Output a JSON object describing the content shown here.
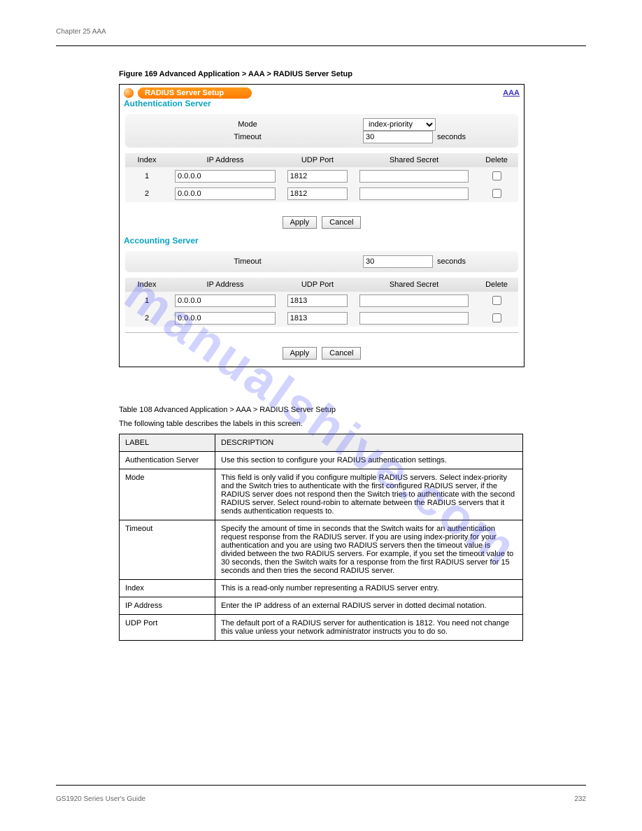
{
  "header": {
    "left": "Chapter 25 AAA",
    "right": ""
  },
  "footer": {
    "left": "GS1920 Series User's Guide",
    "right": "232"
  },
  "fig_caption": "Figure 169   Advanced Application > AAA > RADIUS Server Setup",
  "tbl_caption": "Table 108   Advanced Application > AAA > RADIUS Server Setup",
  "tbl_desc": "The following table describes the labels in this screen.",
  "watermark": "manualshive.com",
  "screenshot": {
    "title": "RADIUS Server Setup",
    "link": "AAA",
    "auth_section": "Authentication Server",
    "acct_section": "Accounting Server",
    "mode_label": "Mode",
    "timeout_label": "Timeout",
    "seconds": "seconds",
    "mode_value": "index-priority",
    "auth_timeout": "30",
    "acct_timeout": "30",
    "cols": {
      "index": "Index",
      "ip": "IP Address",
      "port": "UDP Port",
      "secret": "Shared Secret",
      "del": "Delete"
    },
    "auth_rows": [
      {
        "idx": "1",
        "ip": "0.0.0.0",
        "port": "1812",
        "secret": ""
      },
      {
        "idx": "2",
        "ip": "0.0.0.0",
        "port": "1812",
        "secret": ""
      }
    ],
    "acct_rows": [
      {
        "idx": "1",
        "ip": "0.0.0.0",
        "port": "1813",
        "secret": ""
      },
      {
        "idx": "2",
        "ip": "0.0.0.0",
        "port": "1813",
        "secret": ""
      }
    ],
    "apply": "Apply",
    "cancel": "Cancel"
  },
  "desc_table": {
    "h0": "LABEL",
    "h1": "DESCRIPTION",
    "rows": [
      {
        "label": "Authentication Server",
        "desc": "Use this section to configure your RADIUS authentication settings."
      },
      {
        "label": "Mode",
        "desc": "This field is only valid if you configure multiple RADIUS servers.\nSelect index-priority and the Switch tries to authenticate with the first configured RADIUS server, if the RADIUS server does not respond then the Switch tries to authenticate with the second RADIUS server.\nSelect round-robin to alternate between the RADIUS servers that it sends authentication requests to."
      },
      {
        "label": "Timeout",
        "desc": "Specify the amount of time in seconds that the Switch waits for an authentication request response from the RADIUS server.\nIf you are using index-priority for your authentication and you are using two RADIUS servers then the timeout value is divided between the two RADIUS servers. For example, if you set the timeout value to 30 seconds, then the Switch waits for a response from the first RADIUS server for 15 seconds and then tries the second RADIUS server."
      },
      {
        "label": "Index",
        "desc": "This is a read-only number representing a RADIUS server entry."
      },
      {
        "label": "IP Address",
        "desc": "Enter the IP address of an external RADIUS server in dotted decimal notation."
      },
      {
        "label": "UDP Port",
        "desc": "The default port of a RADIUS server for authentication is 1812. You need not change this value unless your network administrator instructs you to do so."
      }
    ]
  }
}
